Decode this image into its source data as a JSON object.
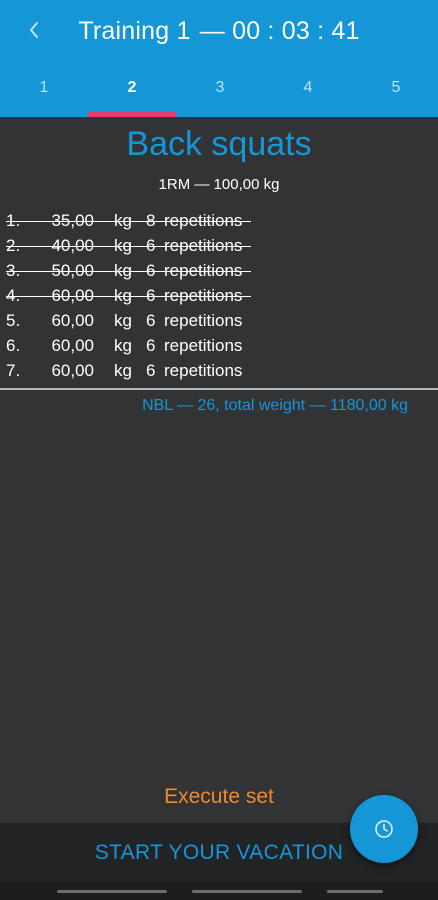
{
  "header": {
    "title": "Training 1",
    "separator": "—",
    "timer": "00 : 03 : 41",
    "back_icon": "chevron-left-icon",
    "color": "#1596d7"
  },
  "tabs": [
    {
      "label": "1",
      "active": false
    },
    {
      "label": "2",
      "active": true
    },
    {
      "label": "3",
      "active": false
    },
    {
      "label": "4",
      "active": false
    },
    {
      "label": "5",
      "active": false
    }
  ],
  "tab_indicator_color": "#e83a6b",
  "exercise": {
    "name": "Back squats",
    "one_rm": "1RM — 100,00 kg"
  },
  "sets": [
    {
      "num": "1.",
      "weight": "35,00",
      "unit": "kg",
      "reps": "8",
      "label": "repetitions",
      "done": true
    },
    {
      "num": "2.",
      "weight": "40,00",
      "unit": "kg",
      "reps": "6",
      "label": "repetitions",
      "done": true
    },
    {
      "num": "3.",
      "weight": "50,00",
      "unit": "kg",
      "reps": "6",
      "label": "repetitions",
      "done": true
    },
    {
      "num": "4.",
      "weight": "60,00",
      "unit": "kg",
      "reps": "6",
      "label": "repetitions",
      "done": true
    },
    {
      "num": "5.",
      "weight": "60,00",
      "unit": "kg",
      "reps": "6",
      "label": "repetitions",
      "done": false
    },
    {
      "num": "6.",
      "weight": "60,00",
      "unit": "kg",
      "reps": "6",
      "label": "repetitions",
      "done": false
    },
    {
      "num": "7.",
      "weight": "60,00",
      "unit": "kg",
      "reps": "6",
      "label": "repetitions",
      "done": false
    }
  ],
  "summary": "NBL — 26, total weight — 1180,00 kg",
  "execute_label": "Execute set",
  "execute_color": "#ee8a2f",
  "vacation_label": "START YOUR VACATION",
  "fab_icon": "clock-icon"
}
